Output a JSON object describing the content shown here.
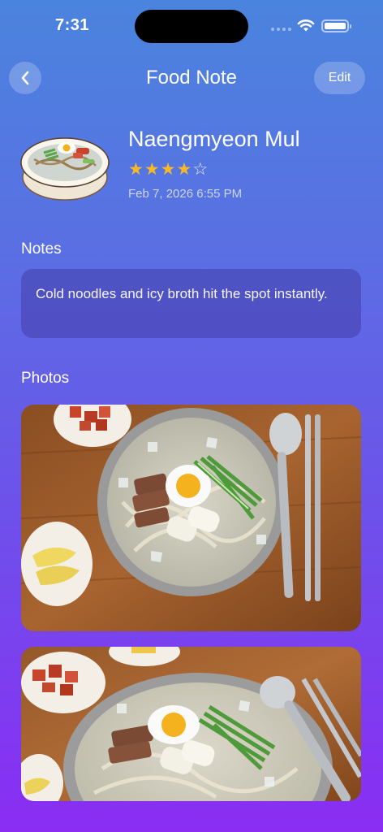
{
  "status": {
    "time": "7:31"
  },
  "nav": {
    "title": "Food Note",
    "edit_label": "Edit",
    "back_icon": "chevron-left-icon"
  },
  "item": {
    "name": "Naengmyeon Mul",
    "rating": 4,
    "rating_max": 5,
    "date": "Feb 7, 2026 6:55 PM"
  },
  "notes": {
    "heading": "Notes",
    "text": "Cold noodles and icy broth hit the spot instantly."
  },
  "photos": {
    "heading": "Photos",
    "count_visible": 2
  },
  "colors": {
    "star": "#f7b928",
    "accent_top": "#4a84de",
    "accent_bottom": "#8a2df3"
  }
}
